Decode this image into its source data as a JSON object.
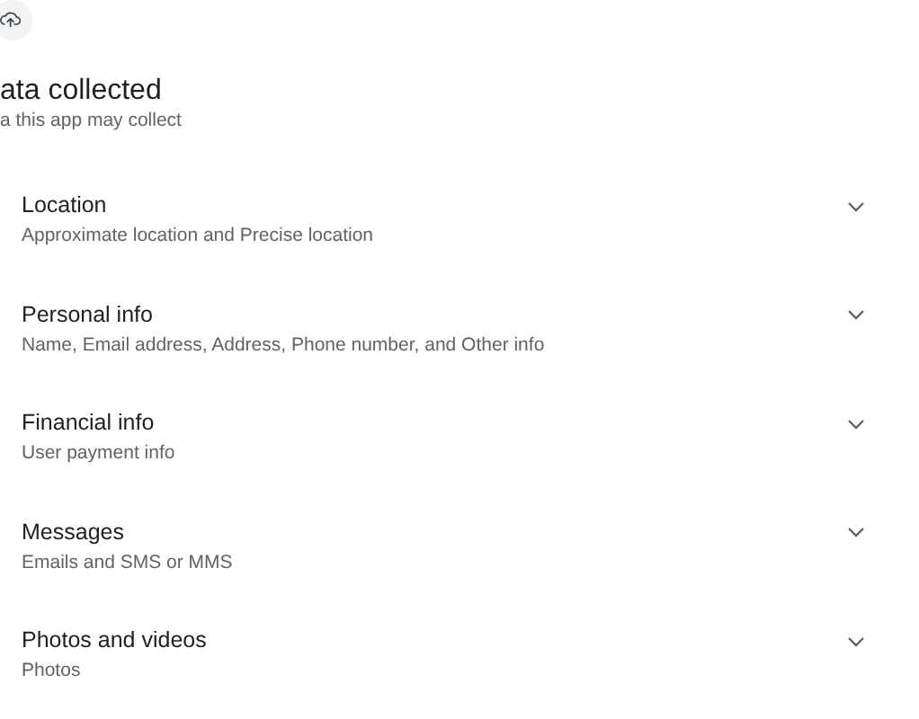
{
  "header": {
    "title": "ata collected",
    "subtitle": "a this app may collect"
  },
  "sections": [
    {
      "title": "Location",
      "detail": "Approximate location and Precise location",
      "expanded": false
    },
    {
      "title": "Personal info",
      "detail": "Name, Email address, Address, Phone number, and Other info",
      "expanded": false
    },
    {
      "title": "Financial info",
      "detail": "User payment info",
      "expanded": false
    },
    {
      "title": "Messages",
      "detail": "Emails and SMS or MMS",
      "expanded": false
    },
    {
      "title": "Photos and videos",
      "detail": "Photos",
      "expanded": false
    }
  ]
}
